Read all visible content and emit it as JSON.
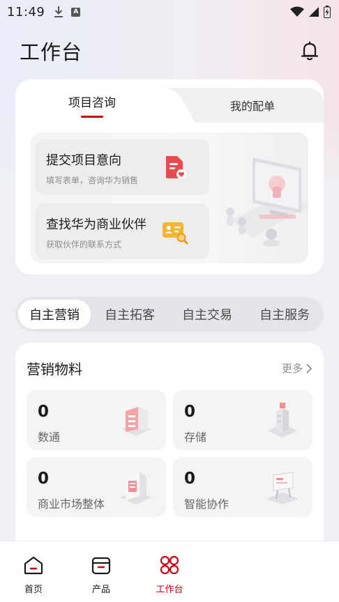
{
  "status_bar": {
    "time": "11:49",
    "badge_letter": "A"
  },
  "header": {
    "title": "工作台",
    "bell_icon": "bell-icon"
  },
  "project_card": {
    "tabs": [
      {
        "label": "项目咨询"
      },
      {
        "label": "我的配单"
      }
    ],
    "items": [
      {
        "title": "提交项目意向",
        "subtitle": "填写表单，咨询华为销售",
        "icon": "form-heart-icon"
      },
      {
        "title": "查找华为商业伙伴",
        "subtitle": "获取伙伴的联系方式",
        "icon": "contact-card-search-icon"
      }
    ]
  },
  "segments": [
    {
      "label": "自主营销"
    },
    {
      "label": "自主拓客"
    },
    {
      "label": "自主交易"
    },
    {
      "label": "自主服务"
    }
  ],
  "marketing": {
    "title": "营销物料",
    "more_label": "更多",
    "tiles": [
      {
        "count": "0",
        "label": "数通"
      },
      {
        "count": "0",
        "label": "存储"
      },
      {
        "count": "0",
        "label": "商业市场整体"
      },
      {
        "count": "0",
        "label": "智能协作"
      }
    ]
  },
  "bottom_nav": [
    {
      "label": "首页",
      "icon": "home-icon"
    },
    {
      "label": "产品",
      "icon": "product-box-icon"
    },
    {
      "label": "工作台",
      "icon": "workbench-grid-icon"
    }
  ],
  "colors": {
    "accent": "#c7000b",
    "background": "#eef0f3",
    "card": "#ffffff"
  }
}
